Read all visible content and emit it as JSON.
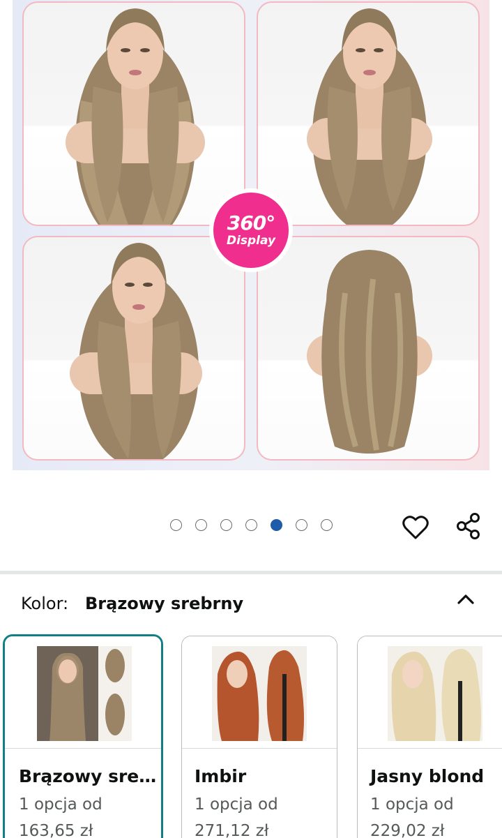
{
  "gallery": {
    "badge_degrees": "360°",
    "badge_label": "Display",
    "dots_total": 7,
    "active_dot_index": 4,
    "hair_color": "#a08a6c",
    "badge_color": "#ef2e8e",
    "frame_color": "#f3b9c2"
  },
  "actions": {
    "wishlist_icon": "heart-icon",
    "share_icon": "share-icon"
  },
  "variation": {
    "label": "Kolor:",
    "selected_value": "Brązowy srebrny",
    "toggle_icon": "chevron-up-icon",
    "selected_border_color": "#127f86",
    "options": [
      {
        "name": "Brązowy sre…",
        "options_text": "1 opcja od",
        "price": "163,65 zł"
      },
      {
        "name": "Imbir",
        "options_text": "1 opcja od",
        "price": "271,12 zł"
      },
      {
        "name": "Jasny blond",
        "options_text": "1 opcja od",
        "price": "229,02 zł"
      }
    ]
  }
}
